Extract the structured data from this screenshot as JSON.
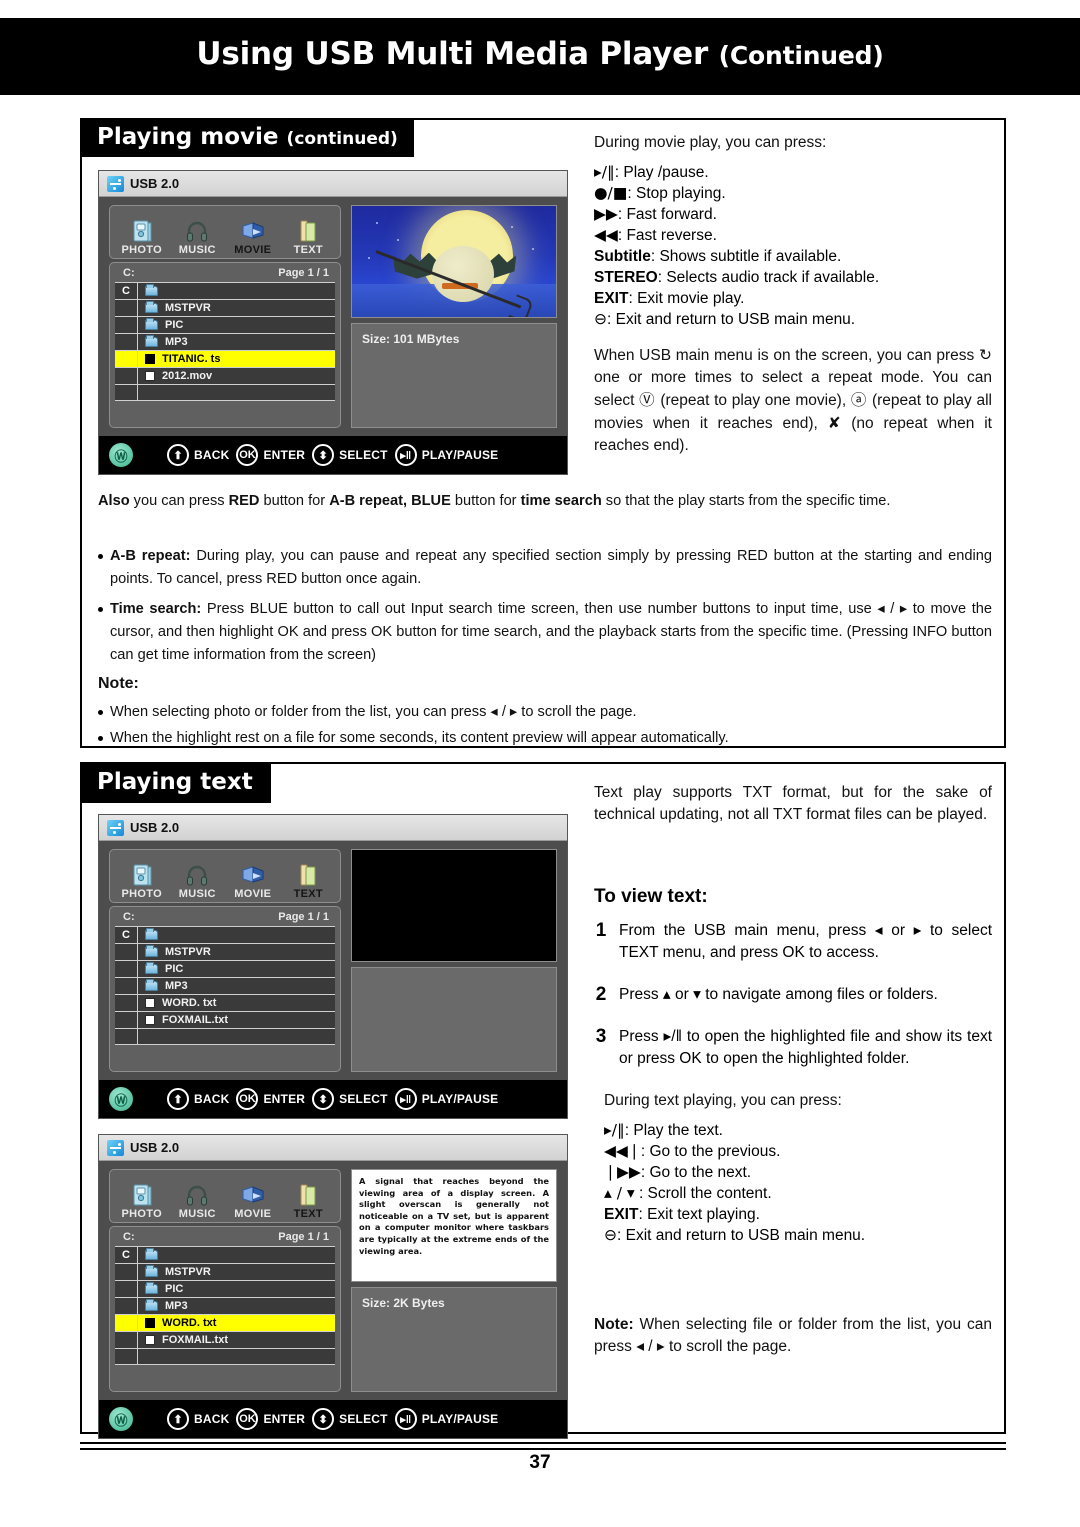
{
  "header": {
    "title": "Using USB Multi Media Player",
    "continued": "(Continued)"
  },
  "sections": {
    "movie": {
      "label": "Playing movie",
      "label_sub": "(continued)",
      "intro": "During movie play, you can press:",
      "key_lines": [
        {
          "key": "▸/‖",
          "text": ": Play /pause."
        },
        {
          "key": "●/■",
          "text": ":  Stop playing."
        },
        {
          "key": "▶▶",
          "text": ": Fast forward."
        },
        {
          "key": "◀◀",
          "text": ": Fast reverse."
        },
        {
          "key": "Subtitle",
          "text": ": Shows subtitle if available.",
          "bold_key": true
        },
        {
          "key": "STEREO",
          "text": ": Selects audio track if available.",
          "bold_key": true
        },
        {
          "key": "EXIT",
          "text": ": Exit movie play.",
          "bold_key": true
        },
        {
          "key": "⊖",
          "text": ": Exit and return to USB main menu."
        }
      ],
      "repeat_para_1": "When USB main menu is on the screen, you can press",
      "repeat_para_2": "one or more times to select a repeat mode. You can select",
      "repeat_para_3": "(repeat to play one movie),",
      "repeat_para_4": "(repeat to play all movies when it reaches end),",
      "repeat_para_5": "(no repeat when it reaches end).",
      "also_para": {
        "p1": "Also",
        "p2": " you can press ",
        "p3": "RED",
        "p4": " button for ",
        "p5": "A-B repeat, BLUE",
        "p6": " button for ",
        "p7": "time search",
        "p8": " so that the play starts from the specific time."
      },
      "bullets": [
        {
          "lead": "A-B repeat:",
          "text": " During play, you can pause and repeat any specified section simply by pressing RED button at the starting and ending points. To cancel, press RED button once again."
        },
        {
          "lead": "Time search:",
          "text": " Press BLUE button to call out Input search time screen, then use number buttons to input time, use ◂ / ▸ to move the cursor, and then highlight OK and press OK button for time search, and the playback starts from the specific time. (Pressing INFO button can get time information from the screen)"
        }
      ],
      "note_title": "Note:",
      "notes": [
        "When selecting photo or folder from the list, you can press ◂ / ▸ to scroll the page.",
        "When the highlight rest on a file for some seconds, its content preview will appear automatically."
      ]
    },
    "text": {
      "label": "Playing text",
      "intro": "Text play supports TXT format, but for the sake of technical updating, not all TXT format files can be played.",
      "subhead": "To view text:",
      "steps": [
        {
          "num": "1",
          "text": "From the USB main menu, press ◂ or ▸ to select TEXT menu, and press OK to access."
        },
        {
          "num": "2",
          "text": "Press ▴ or ▾ to navigate among files or folders."
        },
        {
          "num": "3",
          "text": "Press ▸/‖ to open the highlighted file and show its text or press OK to open the highlighted folder."
        }
      ],
      "during_intro": "During text playing, you can press:",
      "key_lines": [
        {
          "key": "▸/‖",
          "text": ":  Play the text."
        },
        {
          "key": "◀◀❘",
          "text": ": Go to the previous."
        },
        {
          "key": "❘▶▶",
          "text": ": Go to the next."
        },
        {
          "key": "▴ / ▾",
          "text": " : Scroll the content."
        },
        {
          "key": "EXIT",
          "text": ": Exit text playing.",
          "bold_key": true
        },
        {
          "key": "⊖",
          "text": ": Exit and return to USB main menu."
        }
      ],
      "note_lead": "Note:",
      "note_text": " When selecting file or folder from the list, you can  press ◂ / ▸ to scroll the page."
    }
  },
  "tv_screens": {
    "common": {
      "window_title": "USB 2.0",
      "tabs": [
        {
          "label": "PHOTO",
          "icon": "photo-icon"
        },
        {
          "label": "MUSIC",
          "icon": "headphones-icon"
        },
        {
          "label": "MOVIE",
          "icon": "film-icon"
        },
        {
          "label": "TEXT",
          "icon": "document-icon"
        }
      ],
      "drive_label": "C:",
      "page_label": "Page 1 / 1",
      "root_cell": "C",
      "footer_hints": [
        {
          "glyph": "⬆",
          "label": "BACK"
        },
        {
          "glyph": "OK",
          "label": "ENTER"
        },
        {
          "glyph": "⬍",
          "label": "SELECT"
        },
        {
          "glyph": "▸‖",
          "label": "PLAY/PAUSE"
        }
      ],
      "brand_glyph": "Ⓦ"
    },
    "screen1": {
      "active_tab": "MOVIE",
      "rows": [
        {
          "name": "",
          "type": "folder",
          "root": true
        },
        {
          "name": "MSTPVR",
          "type": "folder"
        },
        {
          "name": "PIC",
          "type": "folder"
        },
        {
          "name": "MP3",
          "type": "folder"
        },
        {
          "name": "TITANIC. ts",
          "type": "file",
          "selected": true
        },
        {
          "name": "2012.mov",
          "type": "file"
        },
        {
          "name": "",
          "type": "empty"
        }
      ],
      "size_label": "Size: 101 MBytes",
      "preview": "movie-thumbnail"
    },
    "screen2": {
      "active_tab": "TEXT",
      "rows": [
        {
          "name": "",
          "type": "folder",
          "root": true
        },
        {
          "name": "MSTPVR",
          "type": "folder"
        },
        {
          "name": "PIC",
          "type": "folder"
        },
        {
          "name": "MP3",
          "type": "folder"
        },
        {
          "name": "WORD. txt",
          "type": "file"
        },
        {
          "name": "FOXMAIL.txt",
          "type": "file"
        },
        {
          "name": "",
          "type": "empty"
        }
      ],
      "size_label": "",
      "preview": "blank"
    },
    "screen3": {
      "active_tab": "TEXT",
      "rows": [
        {
          "name": "",
          "type": "folder",
          "root": true
        },
        {
          "name": "MSTPVR",
          "type": "folder"
        },
        {
          "name": "PIC",
          "type": "folder"
        },
        {
          "name": "MP3",
          "type": "folder"
        },
        {
          "name": "WORD. txt",
          "type": "file",
          "selected": true
        },
        {
          "name": "FOXMAIL.txt",
          "type": "file"
        },
        {
          "name": "",
          "type": "empty"
        }
      ],
      "size_label": "Size: 2K Bytes",
      "preview_text": "A signal that reaches beyond the viewing area of a display screen. A slight overscan is generally not noticeable on a TV set, but is apparent on a computer monitor where taskbars are typically at the extreme ends of the viewing area."
    }
  },
  "footer": {
    "page_number": "37"
  },
  "colors": {
    "highlight": "#ffff00",
    "screen_bg": "#4d4d4d",
    "panel": "#606060",
    "row": "#3a3a3a",
    "black": "#000000"
  }
}
